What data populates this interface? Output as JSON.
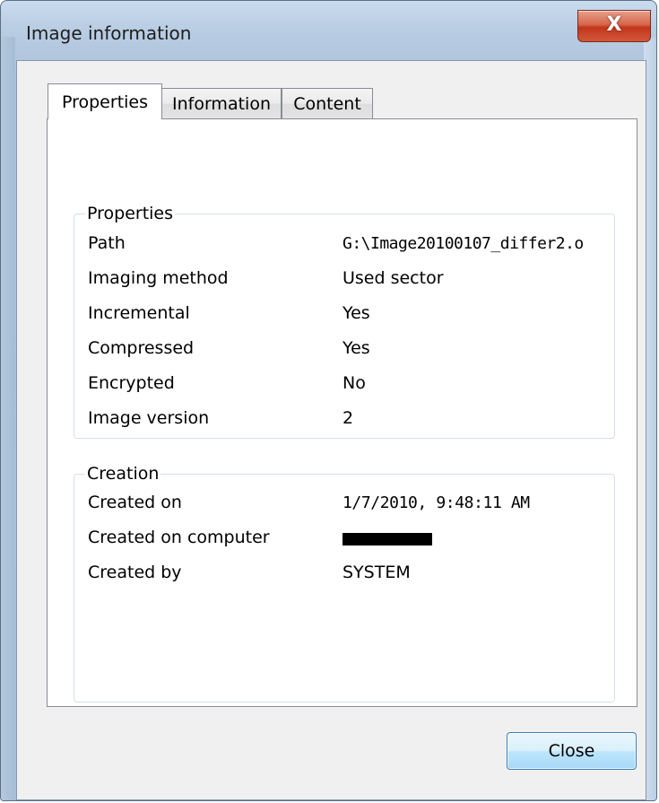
{
  "window": {
    "title": "Image information",
    "close_glyph": "X"
  },
  "tabs": [
    {
      "label": "Properties",
      "active": true
    },
    {
      "label": "Information",
      "active": false
    },
    {
      "label": "Content",
      "active": false
    }
  ],
  "properties_group": {
    "legend": "Properties",
    "rows": [
      {
        "label": "Path",
        "value": "G:\\Image20100107_differ2.o"
      },
      {
        "label": "Imaging method",
        "value": "Used sector"
      },
      {
        "label": "Incremental",
        "value": "Yes"
      },
      {
        "label": "Compressed",
        "value": "Yes"
      },
      {
        "label": "Encrypted",
        "value": "No"
      },
      {
        "label": "Image version",
        "value": "2"
      }
    ]
  },
  "creation_group": {
    "legend": "Creation",
    "rows": [
      {
        "label": "Created on",
        "value": "1/7/2010, 9:48:11 AM"
      },
      {
        "label": "Created on computer",
        "value": "",
        "redacted": true
      },
      {
        "label": "Created by",
        "value": "SYSTEM"
      }
    ]
  },
  "footer": {
    "close_label": "Close"
  },
  "colors": {
    "close_button_accent": "#3c7fb1",
    "title_close_red": "#c2361b",
    "frame_blue": "#b9cde3"
  }
}
